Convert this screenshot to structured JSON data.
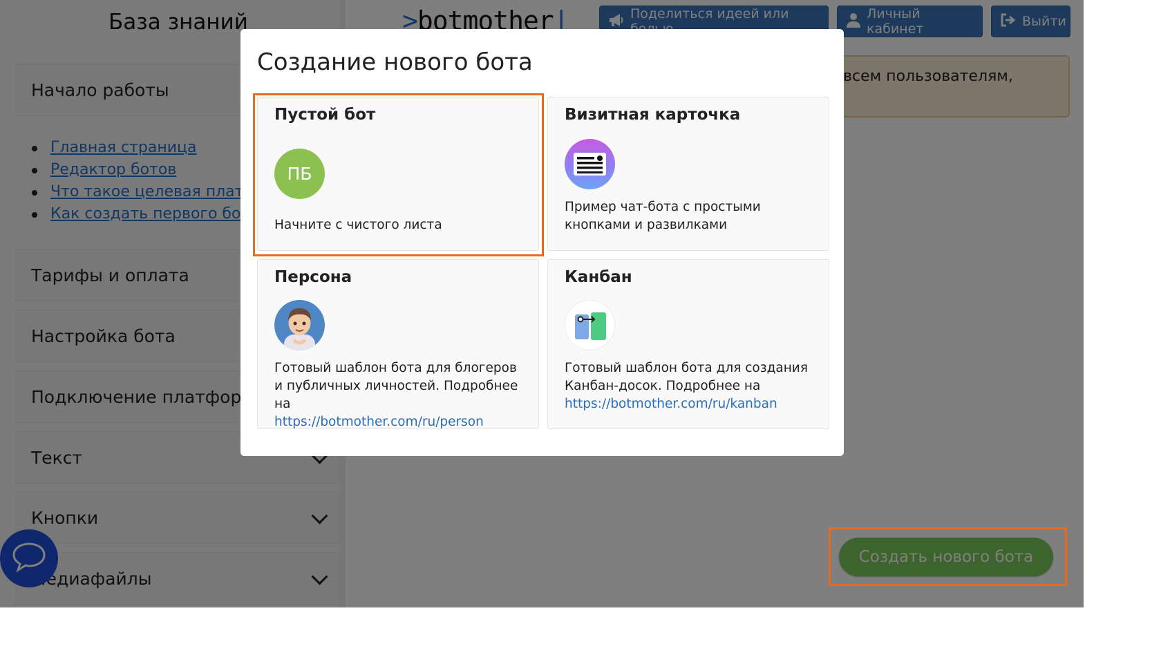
{
  "sidebar": {
    "title": "База знаний",
    "sections": [
      {
        "label": "Начало работы"
      },
      {
        "label": "Тарифы и оплата"
      },
      {
        "label": "Настройка бота"
      },
      {
        "label": "Подключение платформ"
      },
      {
        "label": "Текст"
      },
      {
        "label": "Кнопки"
      },
      {
        "label": "Медиафайлы"
      }
    ],
    "links": [
      "Главная страница",
      "Редактор ботов",
      "Что такое целевая платформа",
      "Как создать первого бота"
    ]
  },
  "header": {
    "logo": "botmother",
    "buttons": {
      "share": "Поделиться идеей или болью",
      "cabinet": "Личный кабинет",
      "logout": "Выйти"
    }
  },
  "notice": {
    "text": "всем пользователям,"
  },
  "create_button": {
    "label": "Создать нового бота"
  },
  "modal": {
    "title": "Создание нового бота",
    "close_glyph": "✖",
    "cards": [
      {
        "title": "Пустой бот",
        "initials": "ПБ",
        "description": "Начните с чистого листа",
        "selected": true
      },
      {
        "title": "Визитная карточка",
        "description": "Пример чат-бота с простыми кнопками и развилками"
      },
      {
        "title": "Персона",
        "description": "Готовый шаблон бота для блогеров и публичных личностей. Подробнее на",
        "link": "https://botmother.com/ru/person"
      },
      {
        "title": "Канбан",
        "description": "Готовый шаблон бота для создания Канбан-досок. Подробнее на",
        "link": "https://botmother.com/ru/kanban"
      }
    ]
  },
  "colors": {
    "accent_blue": "#3a73b9",
    "green_button": "#7cc85a",
    "highlight_orange": "#e86a1e",
    "chat_bubble": "#1f4fd8",
    "link_blue": "#2a6ebb"
  }
}
